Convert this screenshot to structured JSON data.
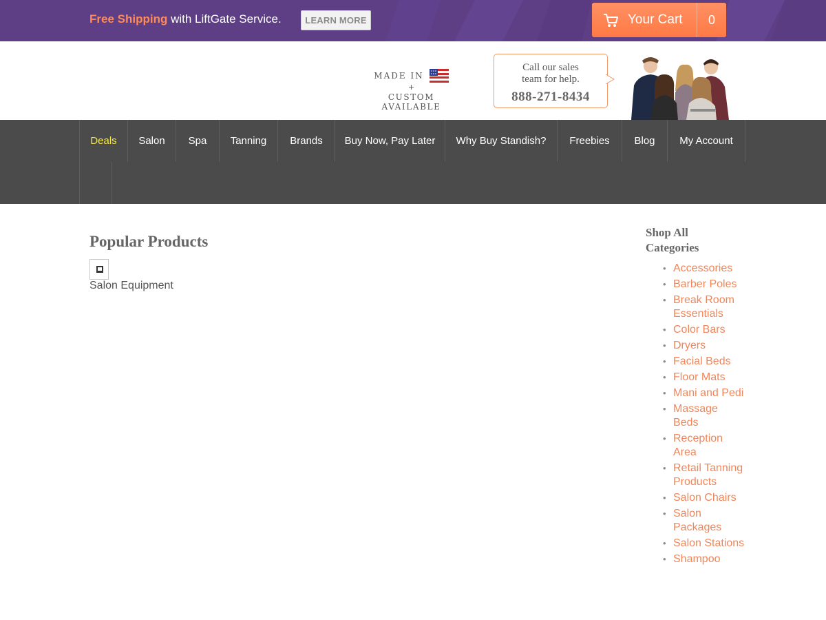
{
  "topbar": {
    "promo_accent": "Free Shipping",
    "promo_rest": " with LiftGate Service.",
    "learn_more": "LEARN MORE",
    "cart_label": "Your Cart",
    "cart_count": "0",
    "accent_color": "#ff8a57",
    "bg_color": "#5e3f86"
  },
  "header": {
    "made_in": "MADE IN",
    "plus": "+",
    "custom": "CUSTOM AVAILABLE",
    "bubble_line1": "Call our sales",
    "bubble_line2": "team for help.",
    "phone": "888-271-8434"
  },
  "nav": {
    "items": [
      {
        "label": "Deals",
        "active": true
      },
      {
        "label": "Salon"
      },
      {
        "label": "Spa"
      },
      {
        "label": "Tanning"
      },
      {
        "label": "Brands"
      },
      {
        "label": "Buy Now, Pay Later"
      },
      {
        "label": "Why Buy Standish?"
      },
      {
        "label": "Freebies"
      },
      {
        "label": "Blog"
      },
      {
        "label": "My Account"
      }
    ]
  },
  "main": {
    "title": "Popular Products",
    "product_label": "Salon Equipment"
  },
  "sidebar": {
    "title": "Shop All Categories",
    "categories": [
      "Accessories",
      "Barber Poles",
      "Break Room Essentials",
      "Color Bars",
      "Dryers",
      "Facial Beds",
      "Floor Mats",
      "Mani and Pedi",
      "Massage Beds",
      "Reception Area",
      "Retail Tanning Products",
      "Salon Chairs",
      "Salon Packages",
      "Salon Stations",
      "Shampoo"
    ]
  }
}
